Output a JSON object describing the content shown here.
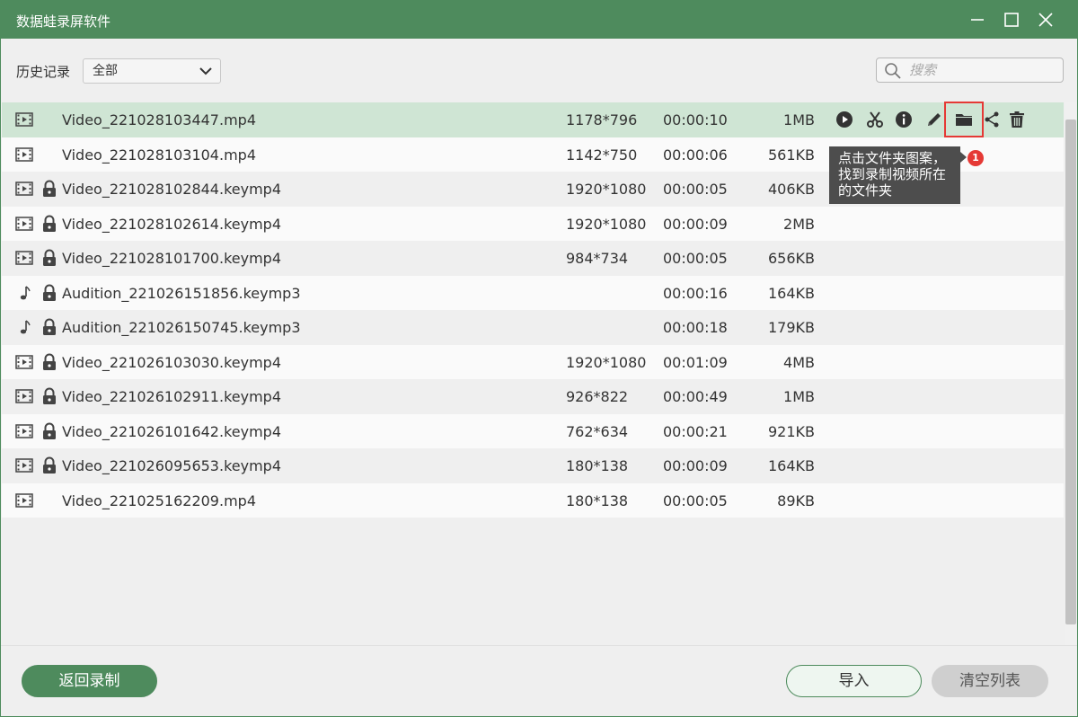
{
  "window": {
    "title": "数据蛙录屏软件"
  },
  "toolbar": {
    "history_label": "历史记录",
    "filter_value": "全部",
    "search_placeholder": "搜索"
  },
  "columns": [
    "name",
    "resolution",
    "duration",
    "size"
  ],
  "files": [
    {
      "type": "video",
      "locked": false,
      "name": "Video_221028103447.mp4",
      "resolution": "1178*796",
      "duration": "00:00:10",
      "size": "1MB",
      "selected": true
    },
    {
      "type": "video",
      "locked": false,
      "name": "Video_221028103104.mp4",
      "resolution": "1142*750",
      "duration": "00:00:06",
      "size": "561KB"
    },
    {
      "type": "video",
      "locked": true,
      "name": "Video_221028102844.keymp4",
      "resolution": "1920*1080",
      "duration": "00:00:05",
      "size": "406KB"
    },
    {
      "type": "video",
      "locked": true,
      "name": "Video_221028102614.keymp4",
      "resolution": "1920*1080",
      "duration": "00:00:09",
      "size": "2MB"
    },
    {
      "type": "video",
      "locked": true,
      "name": "Video_221028101700.keymp4",
      "resolution": "984*734",
      "duration": "00:00:05",
      "size": "656KB"
    },
    {
      "type": "audio",
      "locked": true,
      "name": "Audition_221026151856.keymp3",
      "resolution": "",
      "duration": "00:00:16",
      "size": "164KB"
    },
    {
      "type": "audio",
      "locked": true,
      "name": "Audition_221026150745.keymp3",
      "resolution": "",
      "duration": "00:00:18",
      "size": "179KB"
    },
    {
      "type": "video",
      "locked": true,
      "name": "Video_221026103030.keymp4",
      "resolution": "1920*1080",
      "duration": "00:01:09",
      "size": "4MB"
    },
    {
      "type": "video",
      "locked": true,
      "name": "Video_221026102911.keymp4",
      "resolution": "926*822",
      "duration": "00:00:49",
      "size": "1MB"
    },
    {
      "type": "video",
      "locked": true,
      "name": "Video_221026101642.keymp4",
      "resolution": "762*634",
      "duration": "00:00:21",
      "size": "921KB"
    },
    {
      "type": "video",
      "locked": true,
      "name": "Video_221026095653.keymp4",
      "resolution": "180*138",
      "duration": "00:00:09",
      "size": "164KB"
    },
    {
      "type": "video",
      "locked": false,
      "name": "Video_221025162209.mp4",
      "resolution": "180*138",
      "duration": "00:00:05",
      "size": "89KB"
    }
  ],
  "row_actions": [
    "play-icon",
    "scissors-icon",
    "info-icon",
    "pencil-icon",
    "folder-icon",
    "share-icon",
    "trash-icon"
  ],
  "annotation": {
    "tooltip_text": "点击文件夹图案，找到录制视频所在的文件夹",
    "badge_number": "1"
  },
  "footer": {
    "back_label": "返回录制",
    "import_label": "导入",
    "clear_label": "清空列表"
  },
  "colors": {
    "brand": "#4e8b5d",
    "selected_row": "#cfe5d4",
    "highlight": "#e53935",
    "tooltip_bg": "#4d4d4d"
  }
}
